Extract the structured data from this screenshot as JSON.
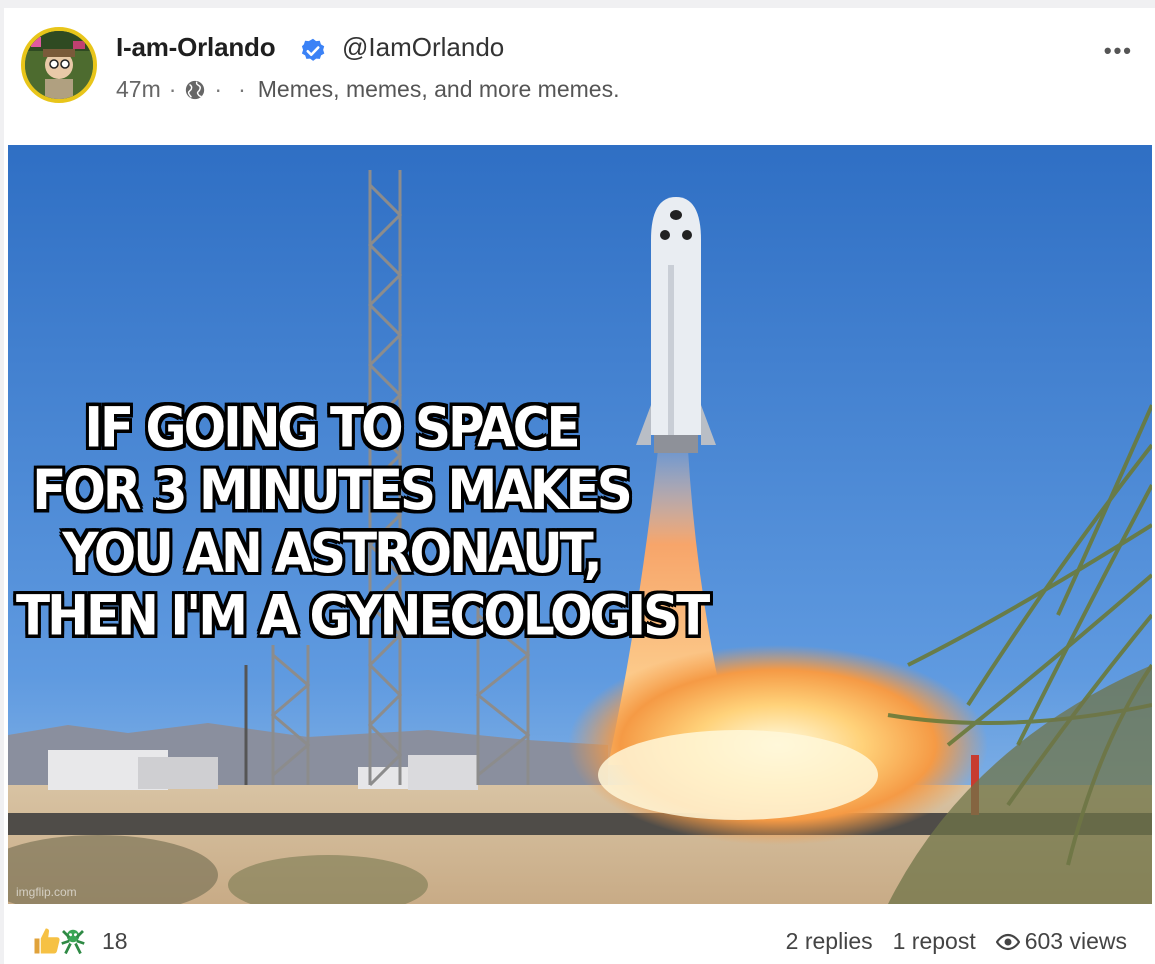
{
  "post": {
    "author": {
      "display_name": "I-am-Orlando",
      "handle": "@IamOrlando",
      "verified": true,
      "avatar_icon": "avatar-cartoon"
    },
    "time_ago": "47m",
    "separator": "·",
    "visibility_icon": "globe-icon",
    "bio": "Memes, memes, and more memes.",
    "more_label": "•••",
    "meme": {
      "lines": [
        "IF GOING TO SPACE",
        "FOR 3 MINUTES MAKES",
        "YOU AN ASTRONAUT,",
        "THEN I'M A GYNECOLOGIST"
      ],
      "watermark": "imgflip.com"
    },
    "reactions": {
      "icons": [
        "thumbs-up-icon",
        "dancing-creature-icon"
      ],
      "count": "18"
    },
    "stats": {
      "replies": "2 replies",
      "reposts": "1 repost",
      "views": "603 views"
    }
  },
  "colors": {
    "verified_blue": "#3b82f6",
    "avatar_ring": "#e8c51a",
    "sky": "#3d78c8"
  }
}
